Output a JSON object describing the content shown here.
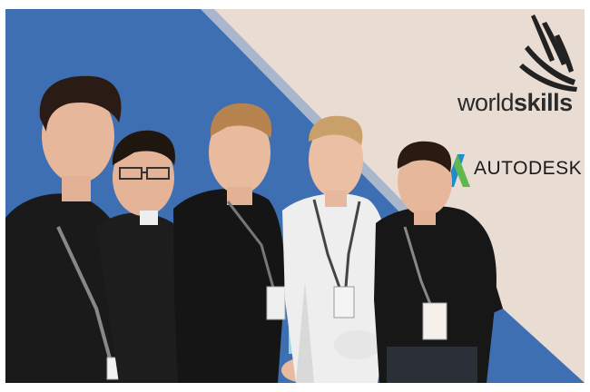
{
  "backdrop": {
    "worldskills_logo": {
      "text_light": "world",
      "text_bold": "skills"
    },
    "autodesk_logo": {
      "text": "AUTODESK"
    }
  },
  "colors": {
    "backdrop_blue": "#3d6fb2",
    "backdrop_beige": "#e9dcd3",
    "logo_dark": "#2b2b2b",
    "shirt_black": "#1a1a1a",
    "shirt_white": "#eeeeee"
  },
  "scene": {
    "people_count": 5
  }
}
